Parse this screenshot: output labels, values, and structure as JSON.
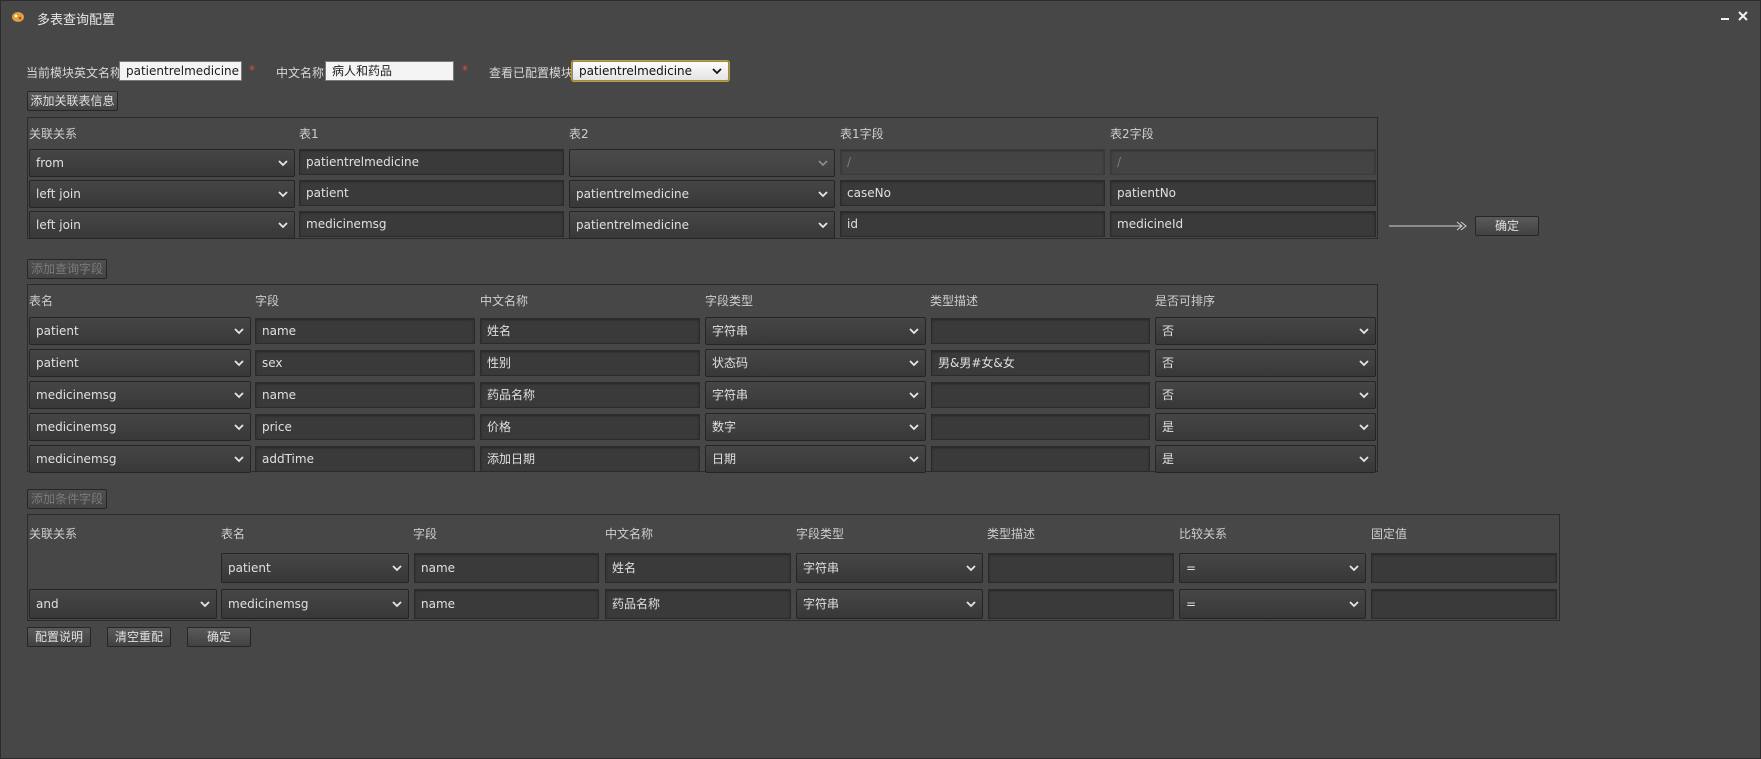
{
  "window": {
    "title": "多表查询配置"
  },
  "header": {
    "module_en_label": "当前模块英文名称",
    "module_en_value": "patientrelmedicine",
    "module_cn_label": "中文名称",
    "module_cn_value": "病人和药品",
    "view_configured_label": "查看已配置模块",
    "view_configured_value": "patientrelmedicine",
    "required_mark": "*"
  },
  "join_section": {
    "add_button": "添加关联表信息",
    "columns": [
      "关联关系",
      "表1",
      "表2",
      "表1字段",
      "表2字段"
    ],
    "rows": [
      {
        "relation": "from",
        "table1": "patientrelmedicine",
        "table2": "",
        "field1": "/",
        "field2": "/"
      },
      {
        "relation": "left join",
        "table1": "patient",
        "table2": "patientrelmedicine",
        "field1": "caseNo",
        "field2": "patientNo"
      },
      {
        "relation": "left join",
        "table1": "medicinemsg",
        "table2": "patientrelmedicine",
        "field1": "id",
        "field2": "medicineId"
      }
    ],
    "confirm_button": "确定"
  },
  "query_section": {
    "add_button": "添加查询字段",
    "columns": [
      "表名",
      "字段",
      "中文名称",
      "字段类型",
      "类型描述",
      "是否可排序"
    ],
    "rows": [
      {
        "table": "patient",
        "field": "name",
        "cn_name": "姓名",
        "type": "字符串",
        "desc": "",
        "sortable": "否"
      },
      {
        "table": "patient",
        "field": "sex",
        "cn_name": "性别",
        "type": "状态码",
        "desc": "男&男#女&女",
        "sortable": "否"
      },
      {
        "table": "medicinemsg",
        "field": "name",
        "cn_name": "药品名称",
        "type": "字符串",
        "desc": "",
        "sortable": "否"
      },
      {
        "table": "medicinemsg",
        "field": "price",
        "cn_name": "价格",
        "type": "数字",
        "desc": "",
        "sortable": "是"
      },
      {
        "table": "medicinemsg",
        "field": "addTime",
        "cn_name": "添加日期",
        "type": "日期",
        "desc": "",
        "sortable": "是"
      }
    ]
  },
  "condition_section": {
    "add_button": "添加条件字段",
    "columns": [
      "关联关系",
      "表名",
      "字段",
      "中文名称",
      "字段类型",
      "类型描述",
      "比较关系",
      "固定值"
    ],
    "rows": [
      {
        "relation": "",
        "table": "patient",
        "field": "name",
        "cn_name": "姓名",
        "type": "字符串",
        "desc": "",
        "compare": "=",
        "fixed": ""
      },
      {
        "relation": "and",
        "table": "medicinemsg",
        "field": "name",
        "cn_name": "药品名称",
        "type": "字符串",
        "desc": "",
        "compare": "=",
        "fixed": ""
      }
    ]
  },
  "footer": {
    "help_button": "配置说明",
    "reset_button": "清空重配",
    "confirm_button": "确定"
  },
  "icons": [
    "app-icon",
    "minimize-icon",
    "close-icon",
    "chevron-down-icon",
    "arrow-right-icon"
  ]
}
